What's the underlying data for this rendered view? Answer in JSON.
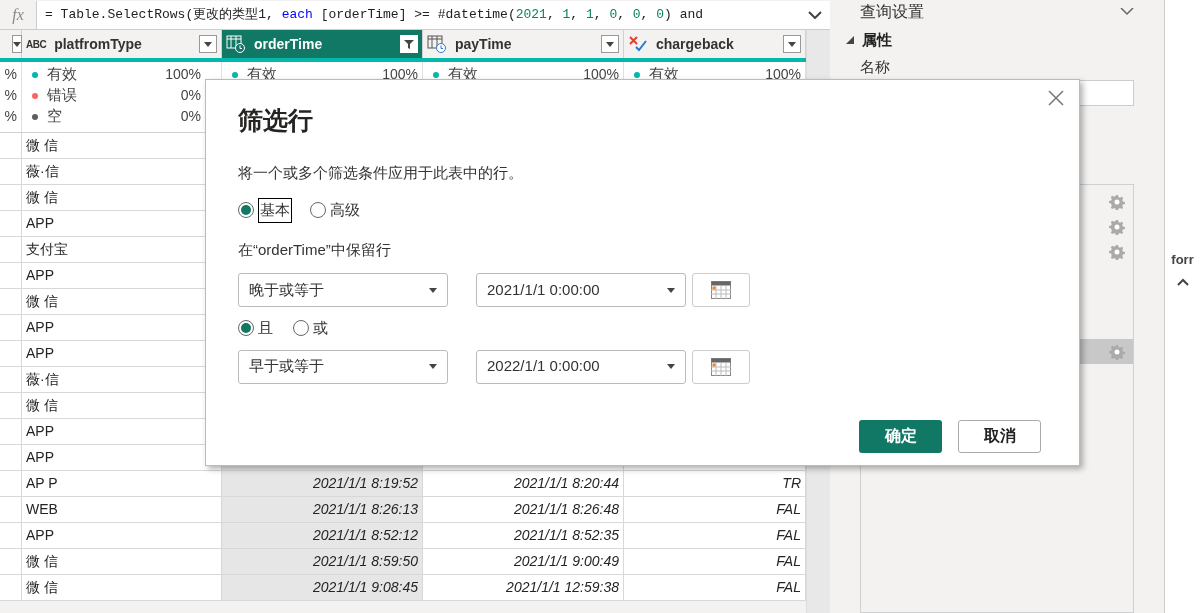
{
  "formula_bar": {
    "fx": "fx",
    "tokens": [
      {
        "kind": "plain",
        "text": "= Table.SelectRows(更改的类型1, "
      },
      {
        "kind": "keyword",
        "text": "each"
      },
      {
        "kind": "plain",
        "text": " [orderTime] >= #datetime("
      },
      {
        "kind": "number",
        "text": "2021"
      },
      {
        "kind": "plain",
        "text": ", "
      },
      {
        "kind": "number",
        "text": "1"
      },
      {
        "kind": "plain",
        "text": ", "
      },
      {
        "kind": "number",
        "text": "1"
      },
      {
        "kind": "plain",
        "text": ", "
      },
      {
        "kind": "number",
        "text": "0"
      },
      {
        "kind": "plain",
        "text": ", "
      },
      {
        "kind": "number",
        "text": "0"
      },
      {
        "kind": "plain",
        "text": ", "
      },
      {
        "kind": "number",
        "text": "0"
      },
      {
        "kind": "plain",
        "text": ") and"
      }
    ]
  },
  "table": {
    "columns": [
      {
        "kind": "cut",
        "selected": false,
        "quality": [
          {
            "pct": "%"
          },
          {
            "pct": "%"
          },
          {
            "pct": "%"
          }
        ]
      },
      {
        "name": "platfromType",
        "kind": "text",
        "type_glyph": "ABC",
        "selected": false,
        "quality": [
          {
            "label": "有效",
            "pct": "100%",
            "color": "#01b8aa"
          },
          {
            "label": "错误",
            "pct": "0%",
            "color": "#fd625e"
          },
          {
            "label": "空",
            "pct": "0%",
            "color": "#605e5c"
          }
        ]
      },
      {
        "name": "orderTime",
        "kind": "datetime",
        "selected": true,
        "quality": [
          {
            "label": "有效",
            "pct": "100%",
            "color": "#01b8aa"
          }
        ]
      },
      {
        "name": "payTime",
        "kind": "datetime",
        "selected": false,
        "quality": [
          {
            "label": "有效",
            "pct": "100%",
            "color": "#01b8aa"
          }
        ]
      },
      {
        "name": "chargeback",
        "kind": "logical",
        "selected": false,
        "quality": [
          {
            "label": "有效",
            "pct": "100%",
            "color": "#01b8aa"
          }
        ]
      }
    ],
    "rows": [
      {
        "platform": "微 信"
      },
      {
        "platform": "薇·信"
      },
      {
        "platform": "微 信"
      },
      {
        "platform": "APP"
      },
      {
        "platform": "支付宝"
      },
      {
        "platform": "APP"
      },
      {
        "platform": "微 信"
      },
      {
        "platform": "APP"
      },
      {
        "platform": "APP"
      },
      {
        "platform": "薇·信"
      },
      {
        "platform": "微 信"
      },
      {
        "platform": "APP"
      },
      {
        "platform": "APP"
      },
      {
        "platform": "AP P",
        "order_time": "2021/1/1 8:19:52",
        "pay_time": "2021/1/1 8:20:44",
        "chargeback": "TR"
      },
      {
        "platform": "WEB",
        "order_time": "2021/1/1 8:26:13",
        "pay_time": "2021/1/1 8:26:48",
        "chargeback": "FAL"
      },
      {
        "platform": "APP",
        "order_time": "2021/1/1 8:52:12",
        "pay_time": "2021/1/1 8:52:35",
        "chargeback": "FAL"
      },
      {
        "platform": "微 信",
        "order_time": "2021/1/1 8:59:50",
        "pay_time": "2021/1/1 9:00:49",
        "chargeback": "FAL"
      },
      {
        "platform": "微 信",
        "order_time": "2021/1/1 9:08:45",
        "pay_time": "2021/1/1 12:59:38",
        "chargeback": "FAL"
      }
    ]
  },
  "query_settings": {
    "title": "查询设置",
    "section": "属性",
    "name_label": "名称",
    "steps": [
      {
        "has_settings": true,
        "selected": false
      },
      {
        "has_settings": true,
        "selected": false
      },
      {
        "has_settings": true,
        "selected": false
      },
      {
        "has_settings": false,
        "selected": false
      },
      {
        "has_settings": false,
        "selected": false
      },
      {
        "has_settings": false,
        "selected": false
      },
      {
        "has_settings": true,
        "selected": true
      }
    ]
  },
  "right_strip": {
    "text": "forr"
  },
  "dialog": {
    "title": "筛选行",
    "description": "将一个或多个筛选条件应用于此表中的行。",
    "modes": [
      {
        "label": "基本",
        "selected": true
      },
      {
        "label": "高级",
        "selected": false
      }
    ],
    "keep_label": "在“orderTime”中保留行",
    "conditions": [
      {
        "operator": "晚于或等于",
        "value": "2021/1/1 0:00:00"
      },
      {
        "operator": "早于或等于",
        "value": "2022/1/1 0:00:00"
      }
    ],
    "joins": [
      {
        "label": "且",
        "selected": true
      },
      {
        "label": "或",
        "selected": false
      }
    ],
    "ok": "确定",
    "cancel": "取消"
  }
}
